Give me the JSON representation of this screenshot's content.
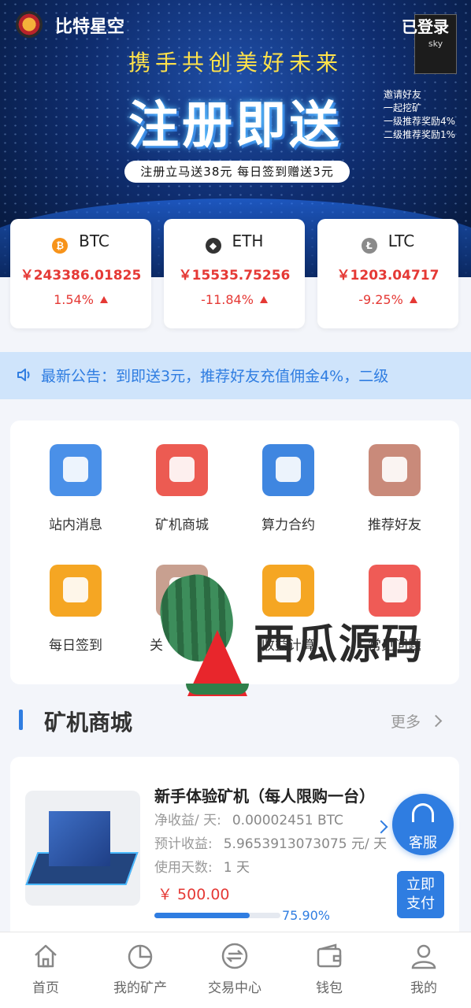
{
  "header": {
    "app_name": "比特星空",
    "login_label": "已登录",
    "badge_text": "sky"
  },
  "banner": {
    "slogan": "携手共创美好未来",
    "headline": "注册即送",
    "invite_lines": [
      "邀请好友",
      "一起挖矿",
      "一级推荐奖励4%",
      "二级推荐奖励1%"
    ],
    "promo": "注册立马送38元 每日签到赠送3元"
  },
  "prices": [
    {
      "symbol": "BTC",
      "price": "￥243386.01825",
      "change": "1.54%",
      "color": "#f7931a",
      "glyph": "₿"
    },
    {
      "symbol": "ETH",
      "price": "￥15535.75256",
      "change": "-11.84%",
      "color": "#333333",
      "glyph": "◆"
    },
    {
      "symbol": "LTC",
      "price": "￥1203.04717",
      "change": "-9.25%",
      "color": "#8a8a8a",
      "glyph": "Ł"
    }
  ],
  "notice": {
    "text": "最新公告：到即送3元，推荐好友充值佣金4%，二级"
  },
  "menu": [
    {
      "label": "站内消息",
      "color": "#4a90e8"
    },
    {
      "label": "矿机商城",
      "color": "#ec5b52"
    },
    {
      "label": "算力合约",
      "color": "#3f86e0"
    },
    {
      "label": "推荐好友",
      "color": "#c98a7a"
    },
    {
      "label": "每日签到",
      "color": "#f5a623"
    },
    {
      "label": "关",
      "color": "#c8a090"
    },
    {
      "label": "收益计算",
      "color": "#f5a623"
    },
    {
      "label": "常见问题",
      "color": "#ef5b56"
    }
  ],
  "watermark": {
    "text": "西瓜源码"
  },
  "section": {
    "title": "矿机商城",
    "more": "更多"
  },
  "product": {
    "name": "新手体验矿机（每人限购一台）",
    "daily_label": "净收益/ 天:",
    "daily_value": "0.00002451 BTC",
    "expected_label": "预计收益:",
    "expected_value": "5.9653913073075 元/ 天",
    "days_label": "使用天数:",
    "days_value": "1 天",
    "price": "￥ 500.00",
    "progress": 0.759,
    "progress_text": "75.90%",
    "pay_line1": "立即",
    "pay_line2": "支付"
  },
  "service": {
    "label": "客服"
  },
  "nav": [
    {
      "label": "首页",
      "icon": "home-icon"
    },
    {
      "label": "我的矿产",
      "icon": "pie-chart-icon"
    },
    {
      "label": "交易中心",
      "icon": "exchange-icon"
    },
    {
      "label": "钱包",
      "icon": "wallet-icon"
    },
    {
      "label": "我的",
      "icon": "user-icon"
    }
  ]
}
